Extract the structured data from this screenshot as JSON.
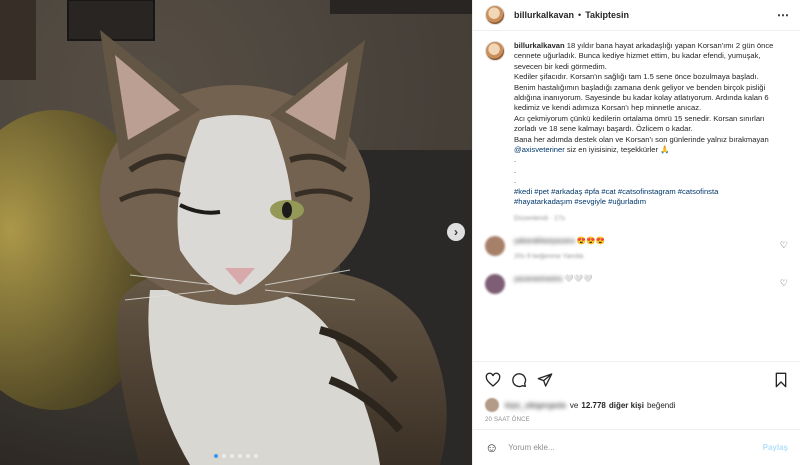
{
  "post": {
    "username": "billurkalkavan",
    "separator": "•",
    "follow_label": "Takiptesin",
    "more_icon": "⋯",
    "caption_lines": [
      "18 yıldır bana hayat arkadaşlığı yapan Korsan'ımı 2 gün önce cennete uğurladık. Bunca kediye hizmet ettim, bu kadar efendi, yumuşak, sevecen bir kedi görmedim.",
      "Kediler şifacıdır. Korsan'ın sağlığı tam 1.5 sene önce bozulmaya başladı. Benim hastalığımın başladığı zamana denk geliyor ve benden birçok pisliği aldığına inanıyorum. Sayesinde bu kadar kolay atlatıyorum. Ardında kalan 6 kedimiz ve kendi adımıza Korsan'ı hep minnetle anıcaz.",
      "Acı çekmiyorum çünkü kedilerin ortalama ömrü 15 senedir. Korsan sınırları zorladı ve 18 sene kalmayı başardı. Özlicem o kadar.",
      "Bana her adımda destek olan ve Korsan'ı son günlerinde yalnız bırakmayan"
    ],
    "mention": "@axisveteriner",
    "caption_end": "siz en iyisisiniz, teşekkürler 🙏",
    "dots": [
      ".",
      ".",
      "."
    ],
    "hashtags": "#kedi #pet #arkadaş #pfa #cat #catsofinstagram #catsofinsta #hayatarkadaşım #sevgiyle #uğurladım",
    "edited": "Düzenlendi · 17s"
  },
  "comments": [
    {
      "user": "yakaraklasiyazara",
      "text": "😍😍😍",
      "meta": "20s 9 beğenme Yanıtla"
    },
    {
      "user": "yazarastrastra",
      "text": "🤍🤍🤍"
    }
  ],
  "actions": {
    "like_icon": "heart-icon",
    "comment_icon": "comment-icon",
    "share_icon": "share-icon",
    "save_icon": "bookmark-icon"
  },
  "likes": {
    "liker": "kişiz_sikigergeda",
    "prefix": "ve",
    "count": "12.778",
    "suffix_bold": "diğer kişi",
    "suffix": "beğendi"
  },
  "timestamp": "20 SAAT ÖNCE",
  "comment_box": {
    "placeholder": "Yorum ekle...",
    "post_label": "Paylaş"
  },
  "carousel": {
    "next": "›",
    "total": 6,
    "active": 0
  },
  "colors": {
    "accent": "#3897f0",
    "link": "#00376b",
    "post_disabled": "#b2dffc"
  }
}
